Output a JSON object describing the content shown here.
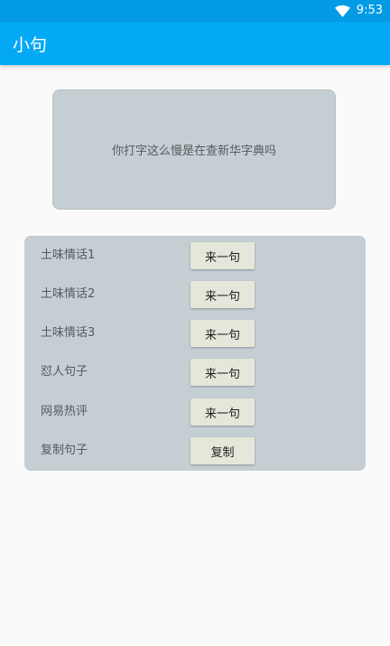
{
  "status_bar": {
    "time": "9:53",
    "icons": [
      "wifi-icon"
    ]
  },
  "app_bar": {
    "title": "小句"
  },
  "quote": {
    "text": "你打字这么慢是在查新华字典吗"
  },
  "options": [
    {
      "label": "土味情话1",
      "button": "来一句"
    },
    {
      "label": "土味情话2",
      "button": "来一句"
    },
    {
      "label": "土味情话3",
      "button": "来一句"
    },
    {
      "label": "怼人句子",
      "button": "来一句"
    },
    {
      "label": "网易热评",
      "button": "来一句"
    },
    {
      "label": "复制句子",
      "button": "复制"
    }
  ],
  "colors": {
    "status_bar": "#039be5",
    "app_bar": "#03a9f4",
    "card_background": "#c5ced3",
    "button_background": "#e4e7d9",
    "page_background": "#fafafa"
  }
}
